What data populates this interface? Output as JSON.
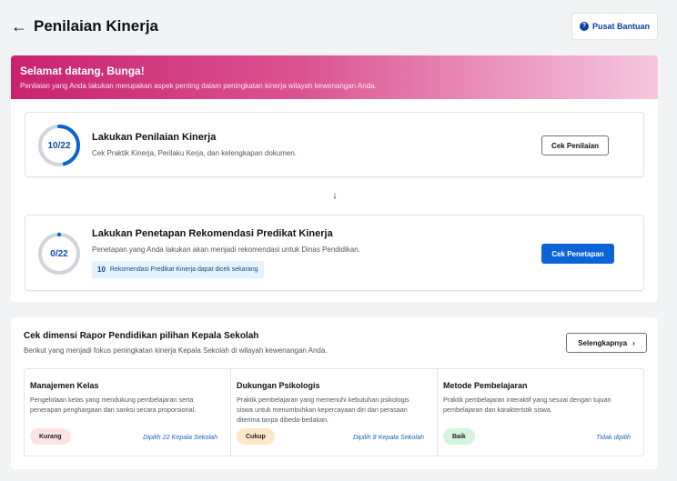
{
  "header": {
    "title": "Penilaian Kinerja",
    "help_label": "Pusat Bantuan"
  },
  "banner": {
    "title": "Selamat datang, Bunga!",
    "subtitle": "Penilaian yang Anda lakukan merupakan aspek penting dalam peningkatan kinerja wilayah kewenangan Anda."
  },
  "steps": [
    {
      "progress_label": "10/22",
      "progress_fraction": 0.4545,
      "title": "Lakukan Penilaian Kinerja",
      "description": "Cek Praktik Kinerja, Perilaku Kerja, dan kelengkapan dokumen.",
      "button": "Cek Penilaian"
    },
    {
      "progress_label": "0/22",
      "progress_fraction": 0,
      "title": "Lakukan Penetapan Rekomendasi Predikat Kinerja",
      "description": "Penetapan yang Anda lakukan akan menjadi rekomendasi untuk Dinas Pendidikan.",
      "info_count": "10",
      "info_text": "Rekomendasi Predikat Kinerja dapat dicek sekarang",
      "button": "Cek Penetapan"
    }
  ],
  "rapor": {
    "title": "Cek dimensi Rapor Pendidikan pilihan Kepala Sekolah",
    "subtitle": "Berikut yang menjadi fokus peningkatan kinerja Kepala Sekolah di wilayah kewenangan Anda.",
    "more_label": "Selengkapnya",
    "dimensions": [
      {
        "title": "Manajemen Kelas",
        "description": "Pengelolaan kelas yang mendukung pembelajaran serta penerapan penghargaan dan sanksi secara proporsional.",
        "badge": "Kurang",
        "chosen": "Dipilih 22 Kepala Sekolah"
      },
      {
        "title": "Dukungan Psikologis",
        "description": "Praktik pembelajaran yang memenuhi kebutuhan psikologis siswa untuk menumbuhkan kepercayaan diri dan perasaan diterima tanpa dibeda-bedakan.",
        "badge": "Cukup",
        "chosen": "Dipilih 8 Kepala Sekolah"
      },
      {
        "title": "Metode Pembelajaran",
        "description": "Praktik pembelajaran interaktif yang sesuai dengan tujuan pembelajaran dan karakteristik siswa.",
        "badge": "Baik",
        "chosen": "Tidak dipilih"
      }
    ]
  },
  "colors": {
    "primary": "#0a64d6",
    "brand_pink": "#c9226f",
    "progress_track": "#d1d5db"
  },
  "icons": {
    "back": "arrow-left-icon",
    "help": "question-circle-icon",
    "step_arrow": "arrow-down-icon",
    "more": "chevron-right-icon"
  }
}
